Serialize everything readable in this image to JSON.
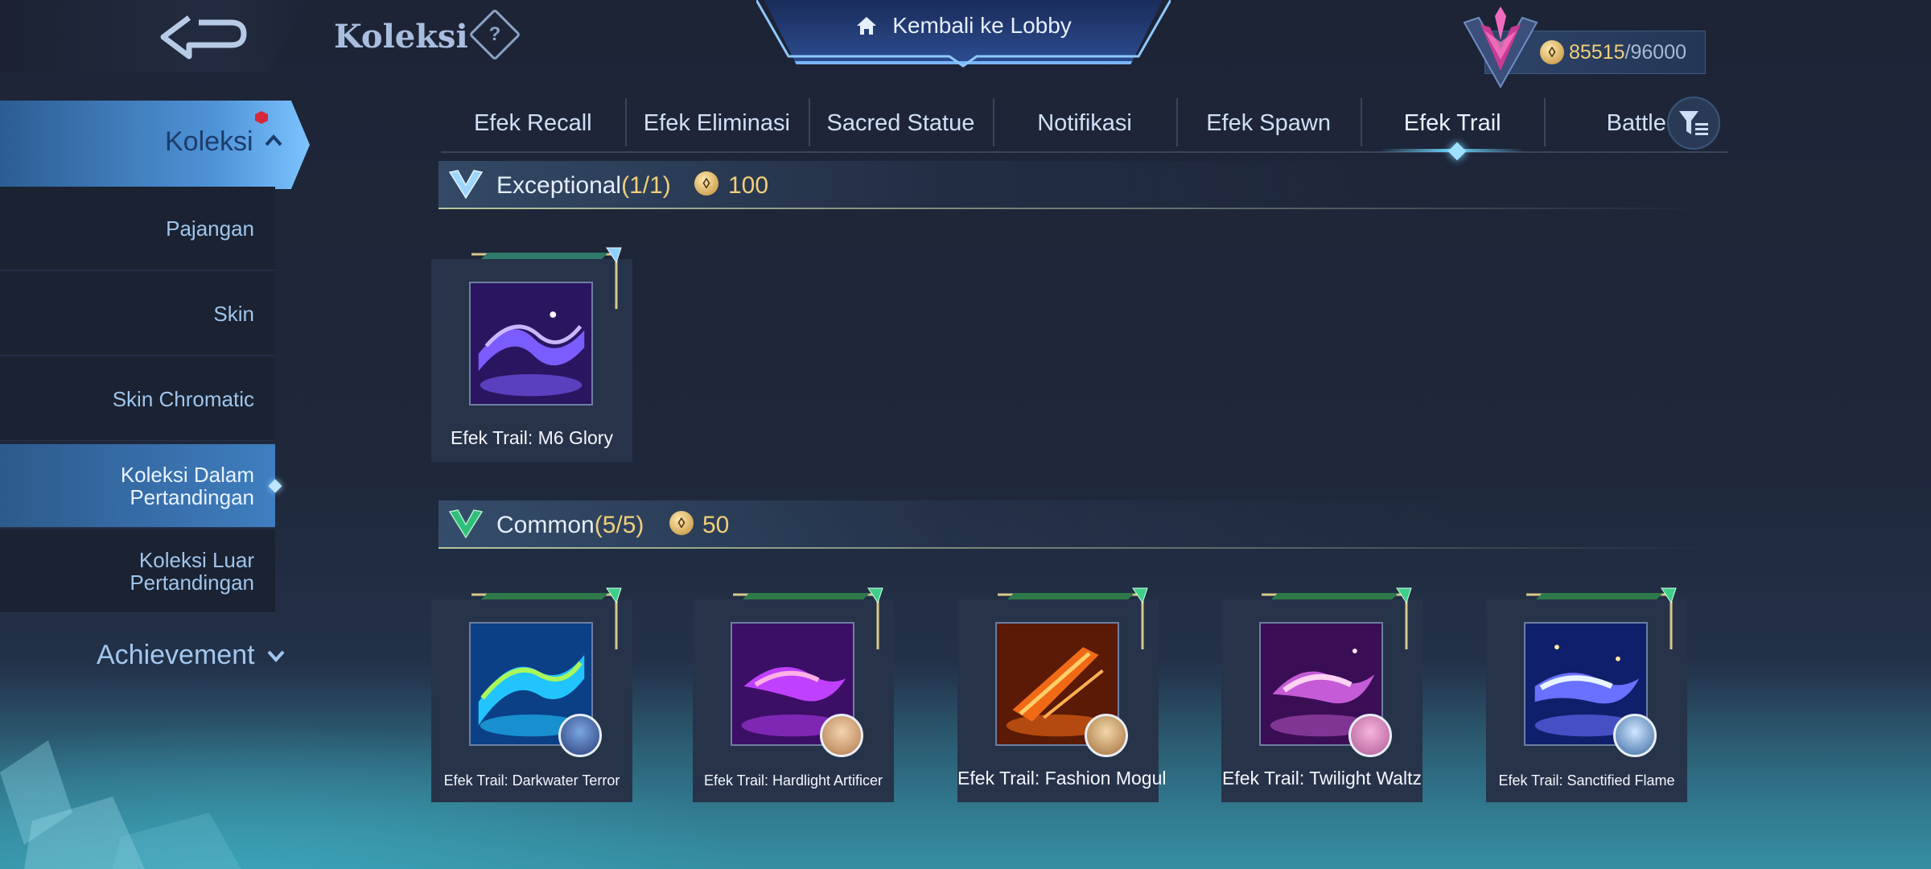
{
  "header": {
    "title": "Koleksi",
    "help_symbol": "?",
    "lobby_button_label": "Kembali ke Lobby",
    "currency": {
      "current": "85515",
      "max": "/96000"
    }
  },
  "sidebar": {
    "main_label": "Koleksi",
    "items": [
      {
        "label": "Pajangan"
      },
      {
        "label": "Skin"
      },
      {
        "label": "Skin Chromatic"
      },
      {
        "label": "Koleksi Dalam Pertandingan",
        "active": true
      },
      {
        "label": "Koleksi Luar Pertandingan"
      }
    ],
    "achievement_label": "Achievement"
  },
  "tabs": [
    {
      "label": "Efek Recall"
    },
    {
      "label": "Efek Eliminasi"
    },
    {
      "label": "Sacred Statue"
    },
    {
      "label": "Notifikasi"
    },
    {
      "label": "Efek Spawn"
    },
    {
      "label": "Efek Trail",
      "active": true
    },
    {
      "label": "Battle"
    }
  ],
  "sections": [
    {
      "title": "Exceptional",
      "count": "(1/1)",
      "price": "100",
      "items": [
        {
          "label": "Efek Trail: M6 Glory",
          "art_colors": [
            "#2a1660",
            "#7b5cff",
            "#c9b8ff"
          ]
        }
      ]
    },
    {
      "title": "Common",
      "count": "(5/5)",
      "price": "50",
      "items": [
        {
          "label": "Efek Trail: Darkwater Terror",
          "art_colors": [
            "#0b3f86",
            "#22c4ff",
            "#aaf75a"
          ]
        },
        {
          "label": "Efek Trail: Hardlight Artificer",
          "art_colors": [
            "#3c0f66",
            "#c040ff",
            "#ffb0e6"
          ]
        },
        {
          "label": "Efek Trail: Fashion Mogul",
          "art_colors": [
            "#5a1a06",
            "#f06a16",
            "#ffd06a"
          ]
        },
        {
          "label": "Efek Trail: Twilight Waltz",
          "art_colors": [
            "#3a0e55",
            "#c55bd6",
            "#ffd2f2"
          ]
        },
        {
          "label": "Efek Trail: Sanctified Flame",
          "art_colors": [
            "#0f1f6b",
            "#6a70ff",
            "#e8f4ff"
          ]
        }
      ]
    }
  ],
  "colors": {
    "accent_gold": "#f1cf7a",
    "tab_active_glow": "#6bd4ff",
    "notification_dot": "#d8283a"
  }
}
